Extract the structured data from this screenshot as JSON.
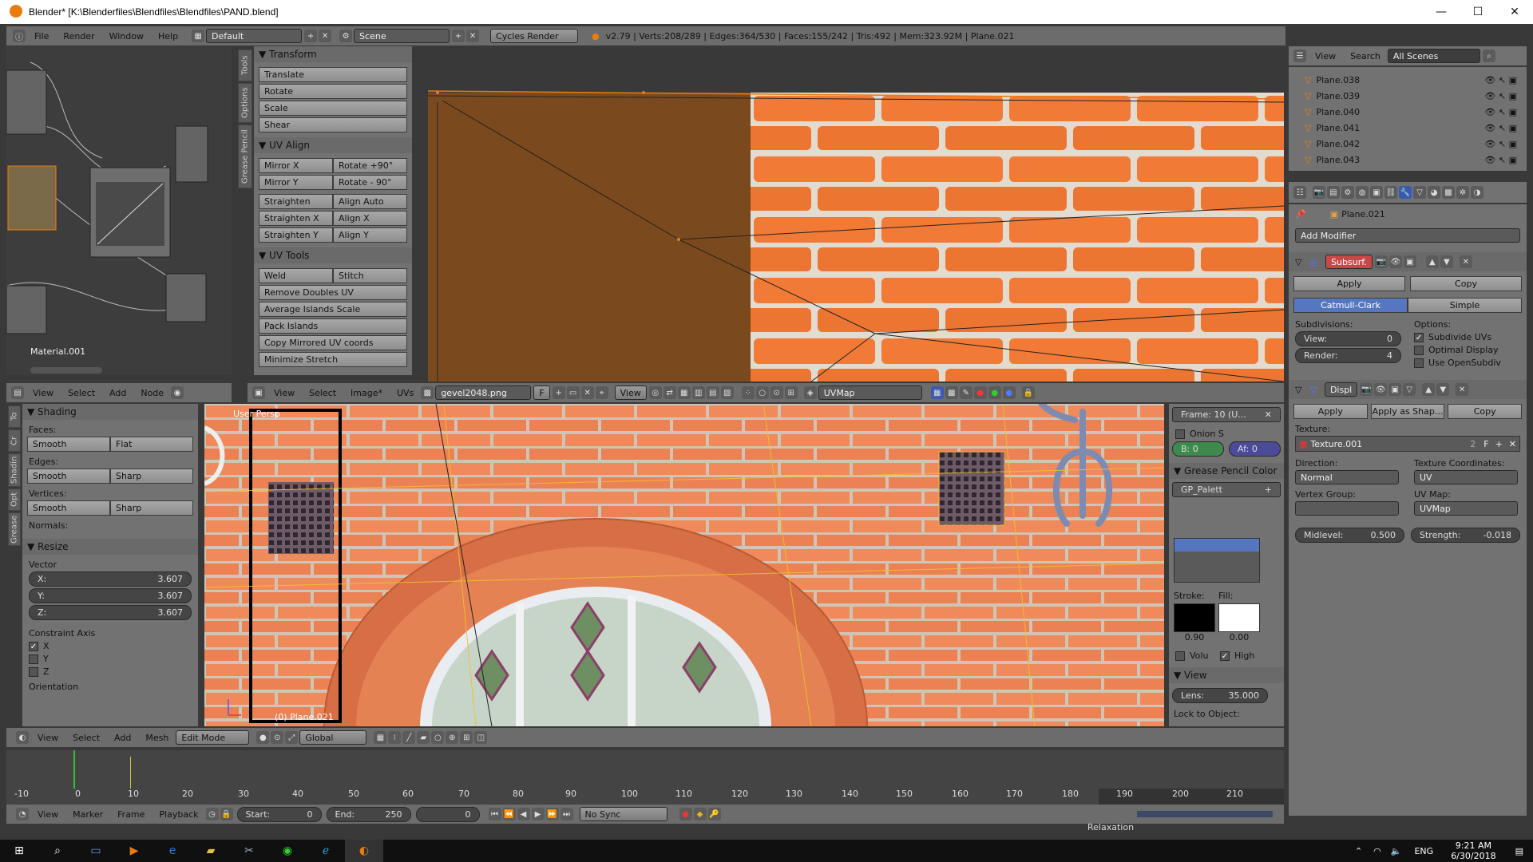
{
  "window": {
    "title": "Blender* [K:\\Blenderfiles\\Blendfiles\\Blendfiles\\PAND.blend]",
    "min": "—",
    "max": "☐",
    "close": "✕"
  },
  "info": {
    "menus": [
      "File",
      "Render",
      "Window",
      "Help"
    ],
    "layout": "Default",
    "scene": "Scene",
    "engine": "Cycles Render",
    "stats": "v2.79 | Verts:208/289 | Edges:364/530 | Faces:155/242 | Tris:492 | Mem:323.92M | Plane.021"
  },
  "node_editor": {
    "material": "Material.001",
    "menus": [
      "View",
      "Select",
      "Add",
      "Node"
    ]
  },
  "uv_tools": {
    "tabs": [
      "Tools",
      "Options",
      "Grease Pencil"
    ],
    "transform": {
      "title": "Transform",
      "buttons": [
        "Translate",
        "Rotate",
        "Scale",
        "Shear"
      ]
    },
    "uv_align": {
      "title": "UV Align",
      "rows": [
        [
          "Mirror X",
          "Rotate +90°"
        ],
        [
          "Mirror Y",
          "Rotate - 90°"
        ],
        [
          "Straighten",
          "Align Auto"
        ],
        [
          "Straighten X",
          "Align X"
        ],
        [
          "Straighten Y",
          "Align Y"
        ]
      ]
    },
    "uv_tools": {
      "title": "UV Tools",
      "weld": "Weld",
      "stitch": "Stitch",
      "buttons": [
        "Remove Doubles UV",
        "Average Islands Scale",
        "Pack Islands",
        "Copy Mirrored UV coords",
        "Minimize Stretch"
      ]
    }
  },
  "uv_header": {
    "menus": [
      "View",
      "Select",
      "Image*",
      "UVs"
    ],
    "image": "gevel2048.png",
    "f": "F",
    "view": "View",
    "uvmap": "UVMap"
  },
  "tool_shelf": {
    "tabs": [
      "To",
      "Cr",
      "Shadin",
      "Opt",
      "Grease"
    ],
    "shading": {
      "title": "Shading",
      "faces": "Faces:",
      "faces_btns": [
        "Smooth",
        "Flat"
      ],
      "edges": "Edges:",
      "edges_btns": [
        "Smooth",
        "Sharp"
      ],
      "vertices": "Vertices:",
      "vert_btns": [
        "Smooth",
        "Sharp"
      ],
      "normals": "Normals:"
    },
    "resize": {
      "title": "Resize",
      "vector": "Vector",
      "x_label": "X:",
      "x": "3.607",
      "y_label": "Y:",
      "y": "3.607",
      "z_label": "Z:",
      "z": "3.607",
      "constraint": "Constraint Axis",
      "axes": [
        "X",
        "Y",
        "Z"
      ],
      "axes_checked": [
        true,
        false,
        false
      ],
      "orientation": "Orientation"
    }
  },
  "viewport": {
    "label": "User Persp",
    "object": "(0) Plane.021"
  },
  "grease": {
    "frame": "Frame: 10 (U...",
    "onion": "Onion S",
    "b": "B: 0",
    "af": "Af: 0",
    "color_title": "Grease Pencil Color",
    "palette": "GP_Palett",
    "stroke": "Stroke:",
    "fill": "Fill:",
    "stroke_val": "0.90",
    "fill_val": "0.00",
    "volu": "Volu",
    "high": "High",
    "view_title": "View",
    "lens_label": "Lens:",
    "lens": "35.000",
    "lock": "Lock to Object:"
  },
  "view3d_header": {
    "menus": [
      "View",
      "Select",
      "Add",
      "Mesh"
    ],
    "mode": "Edit Mode",
    "orient": "Global"
  },
  "timeline": {
    "ticks": [
      "-10",
      "0",
      "10",
      "20",
      "30",
      "40",
      "50",
      "60",
      "70",
      "80",
      "90",
      "100",
      "110",
      "120",
      "130",
      "140",
      "150",
      "160",
      "170",
      "180",
      "190",
      "200",
      "210"
    ],
    "menus": [
      "View",
      "Marker",
      "Frame",
      "Playback"
    ],
    "start_label": "Start:",
    "start": "0",
    "end_label": "End:",
    "end": "250",
    "current": "0",
    "sync": "No Sync"
  },
  "outliner": {
    "menus": [
      "View",
      "Search"
    ],
    "scenes": "All Scenes",
    "items": [
      "Plane.038",
      "Plane.039",
      "Plane.040",
      "Plane.041",
      "Plane.042",
      "Plane.043"
    ]
  },
  "properties": {
    "object": "Plane.021",
    "add_modifier": "Add Modifier",
    "subsurf": {
      "name": "Subsurf.",
      "apply": "Apply",
      "copy": "Copy",
      "tabs": [
        "Catmull-Clark",
        "Simple"
      ],
      "subdivisions": "Subdivisions:",
      "options": "Options:",
      "view_label": "View:",
      "view": "0",
      "render_label": "Render:",
      "render": "4",
      "opts": [
        "Subdivide UVs",
        "Optimal Display",
        "Use OpenSubdiv"
      ],
      "opts_checked": [
        true,
        false,
        false
      ]
    },
    "displace": {
      "name": "Displ",
      "apply": "Apply",
      "apply_shape": "Apply as Shap...",
      "copy": "Copy",
      "texture_label": "Texture:",
      "texture": "Texture.001",
      "users": "2",
      "f": "F",
      "direction_label": "Direction:",
      "direction": "Normal",
      "texcoords_label": "Texture Coordinates:",
      "texcoords": "UV",
      "vgroup_label": "Vertex Group:",
      "uvmap_label": "UV Map:",
      "uvmap": "UVMap",
      "midlevel_label": "Midlevel:",
      "midlevel": "0.500",
      "strength_label": "Strength:",
      "strength": "-0.018"
    }
  },
  "taskbar": {
    "lang": "ENG",
    "time": "9:21 AM",
    "date": "6/30/2018",
    "relax": "Relaxation"
  }
}
